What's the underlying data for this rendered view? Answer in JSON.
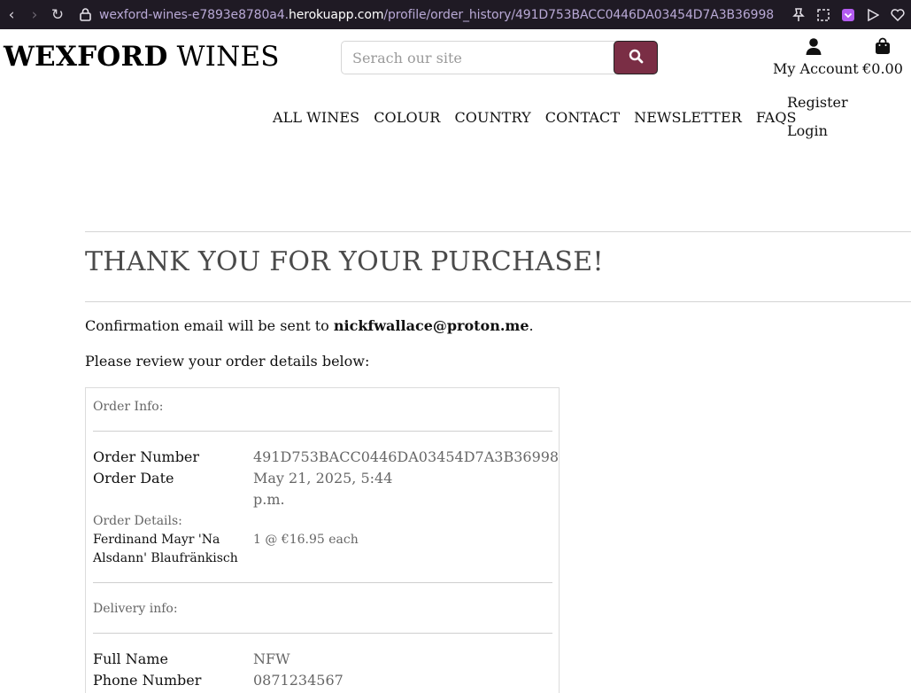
{
  "browser": {
    "url_prefix": "wexford-wines-e7893e8780a4.",
    "url_host": "herokuapp.com",
    "url_path": "/profile/order_history/491D753BACC0446DA03454D7A3B36998"
  },
  "site": {
    "logo_bold": "WEXFORD",
    "logo_light": " WINES",
    "search_placeholder": "Serach our site",
    "my_account": "My Account",
    "bag_total": "€0.00",
    "nav": [
      "ALL WINES",
      "COLOUR",
      "COUNTRY",
      "CONTACT",
      "NEWSLETTER",
      "FAQS"
    ],
    "account_menu": [
      "Register",
      "Login"
    ],
    "brand_color": "#7a2e45"
  },
  "page": {
    "title": "THANK YOU FOR YOUR PURCHASE!",
    "confirm_prefix": "Confirmation email will be sent to ",
    "confirm_email": "nickfwallace@proton.me",
    "confirm_suffix": ".",
    "review_text": "Please review your order details below:"
  },
  "order": {
    "info_label": "Order Info:",
    "number_label": "Order Number",
    "number_value": "491D753BACC0446DA03454D7A3B36998",
    "date_label": "Order Date",
    "date_value_line1": "May 21, 2025, 5:44",
    "date_value_line2": "p.m.",
    "details_label": "Order Details:",
    "item_name": "Ferdinand Mayr 'Na Alsdann' Blaufränkisch",
    "item_qty_price": "1 @ €16.95 each",
    "delivery_label": "Delivery info:",
    "full_name_label": "Full Name",
    "full_name_value": "NFW",
    "phone_label": "Phone Number",
    "phone_value": "0871234567"
  }
}
